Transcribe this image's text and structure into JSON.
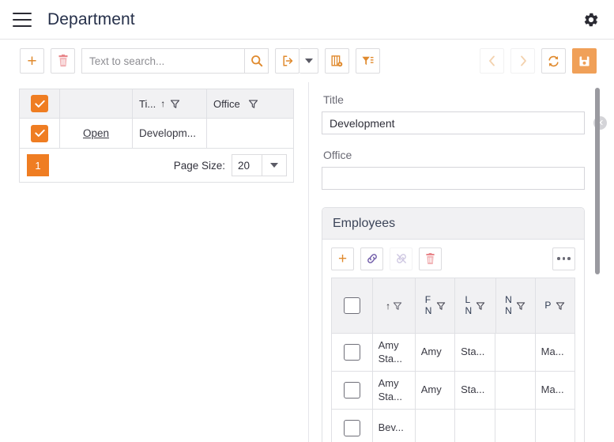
{
  "header": {
    "title": "Department",
    "menu_icon": "hamburger-icon",
    "settings_icon": "gear-icon"
  },
  "toolbar": {
    "add_label": "+",
    "delete_icon": "trash-icon",
    "search": {
      "value": "",
      "placeholder": "Text to search..."
    },
    "search_icon": "magnifier-icon",
    "export_icon": "export-icon",
    "export_caret": "chevron-down-icon",
    "columns_icon": "column-settings-icon",
    "filter_icon": "filter-list-icon",
    "prev_icon": "chevron-left-icon",
    "next_icon": "chevron-right-icon",
    "refresh_icon": "refresh-icon",
    "save_icon": "save-icon"
  },
  "grid": {
    "columns": [
      {
        "key": "check",
        "label": ""
      },
      {
        "key": "open",
        "label": ""
      },
      {
        "key": "title",
        "label": "Ti...",
        "sorted": "asc",
        "filter": true
      },
      {
        "key": "office",
        "label": "Office",
        "filter": true
      }
    ],
    "header_select_all": true,
    "rows": [
      {
        "checked": true,
        "open": "Open",
        "title": "Developm...",
        "office": ""
      }
    ],
    "footer": {
      "page": "1",
      "page_size_label": "Page Size:",
      "page_size_value": "20"
    }
  },
  "detail": {
    "fields": [
      {
        "label": "Title",
        "value": "Development",
        "clearable": true
      },
      {
        "label": "Office",
        "value": "",
        "clearable": false
      }
    ],
    "employees": {
      "title": "Employees",
      "toolbar": {
        "add_label": "+",
        "link_icon": "link-icon",
        "unlink_icon": "unlink-icon",
        "delete_icon": "trash-icon",
        "more_icon": "ellipsis-icon"
      },
      "columns": [
        {
          "key": "check",
          "label": ""
        },
        {
          "key": "name",
          "label": "",
          "sorted": "asc",
          "filter": true
        },
        {
          "key": "first",
          "label": "FN",
          "filter": true
        },
        {
          "key": "last",
          "label": "LN",
          "filter": true
        },
        {
          "key": "middle",
          "label": "NN",
          "filter": true
        },
        {
          "key": "position",
          "label": "P",
          "filter": true
        }
      ],
      "rows": [
        {
          "checked": false,
          "name": "Amy Sta...",
          "first": "Amy",
          "last": "Sta...",
          "middle": "",
          "position": "Ma..."
        },
        {
          "checked": false,
          "name": "Amy Sta...",
          "first": "Amy",
          "last": "Sta...",
          "middle": "",
          "position": "Ma..."
        },
        {
          "checked": false,
          "name": "Bev...",
          "first": "",
          "last": "",
          "middle": "",
          "position": ""
        }
      ]
    }
  },
  "colors": {
    "accent": "#ef7d22",
    "accent_soft": "#f0a058",
    "icon_orange": "#e08a2e",
    "danger": "#e8868a",
    "link_purple": "#6f5ba8",
    "title_navy": "#26304a"
  }
}
